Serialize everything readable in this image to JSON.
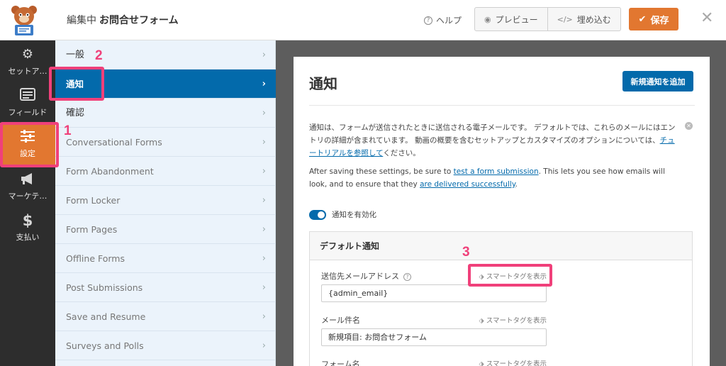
{
  "header": {
    "editing_prefix": "編集中",
    "form_name": "お問合せフォーム",
    "help_label": "ヘルプ",
    "preview_label": "プレビュー",
    "embed_label": "埋め込む",
    "save_label": "保存"
  },
  "leftnav": {
    "items": [
      {
        "label": "セットア…",
        "icon": "gear-icon"
      },
      {
        "label": "フィールド",
        "icon": "fields-list-icon"
      },
      {
        "label": "設定",
        "icon": "sliders-icon",
        "active": true
      },
      {
        "label": "マーケテ…",
        "icon": "megaphone-icon"
      },
      {
        "label": "支払い",
        "icon": "dollar-icon"
      }
    ]
  },
  "settings_panel": {
    "items": [
      {
        "label": "一般"
      },
      {
        "label": "通知",
        "selected": true
      },
      {
        "label": "確認"
      },
      {
        "label": "Conversational Forms"
      },
      {
        "label": "Form Abandonment"
      },
      {
        "label": "Form Locker"
      },
      {
        "label": "Form Pages"
      },
      {
        "label": "Offline Forms"
      },
      {
        "label": "Post Submissions"
      },
      {
        "label": "Save and Resume"
      },
      {
        "label": "Surveys and Polls"
      }
    ]
  },
  "main": {
    "title": "通知",
    "add_button": "新規通知を追加",
    "desc_part1": "通知は、フォームが送信されたときに送信される電子メールです。 デフォルトでは、これらのメールにはエントリの詳細が含まれています。 動画の概要を含むセットアップとカスタマイズのオプションについては、",
    "desc_link": "チュートリアルを参照して",
    "desc_part2": "ください。",
    "after_part1": "After saving these settings, be sure to ",
    "after_link1": "test a form submission",
    "after_part2": ". This lets you see how emails will look, and to ensure that they ",
    "after_link2": "are delivered successfully",
    "after_part3": ".",
    "toggle_label": "通知を有効化",
    "box_title": "デフォルト通知",
    "smart_tag_label": "スマートタグを表示",
    "fields": [
      {
        "label": "送信先メールアドレス",
        "value": "{admin_email}"
      },
      {
        "label": "メール件名",
        "value": "新規項目: お問合せフォーム"
      },
      {
        "label": "フォーム名",
        "value": ""
      }
    ]
  },
  "annotations": {
    "n1": "1",
    "n2": "2",
    "n3": "3"
  },
  "colors": {
    "accent_orange": "#e27730",
    "primary_blue": "#036aab",
    "highlight_pink": "#f0407a"
  }
}
